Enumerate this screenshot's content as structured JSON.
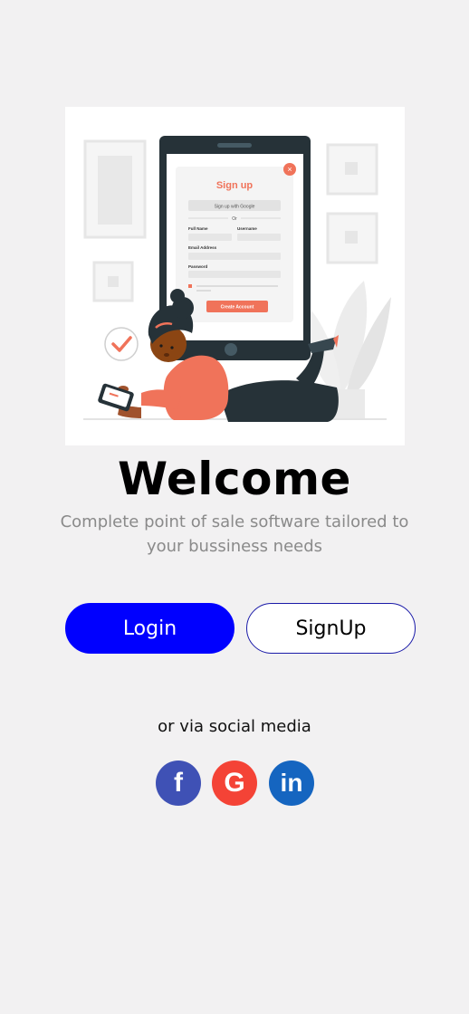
{
  "hero": {
    "illustration": "person-signing-up-on-tablet",
    "form_title": "Sign up",
    "google_button": "Sign up with Google",
    "or": "Or",
    "full_name_label": "Full Name",
    "username_label": "Username",
    "email_label": "Email Address",
    "password_label": "Password",
    "create_button": "Create Account"
  },
  "welcome": {
    "title": "Welcome",
    "subtitle": "Complete point of sale software tailored to your bussiness needs"
  },
  "actions": {
    "login_label": "Login",
    "signup_label": "SignUp"
  },
  "social": {
    "label": "or via social media",
    "facebook_glyph": "f",
    "google_glyph": "G",
    "linkedin_glyph": "in",
    "facebook_icon": "facebook-icon",
    "google_icon": "google-icon",
    "linkedin_icon": "linkedin-icon"
  },
  "colors": {
    "background": "#f2f1f2",
    "login_button": "#0000ff",
    "signup_border": "#1a1aa8",
    "facebook": "#3f51b5",
    "google": "#f44336",
    "linkedin": "#1565c0",
    "accent_illustration": "#f0735a"
  }
}
